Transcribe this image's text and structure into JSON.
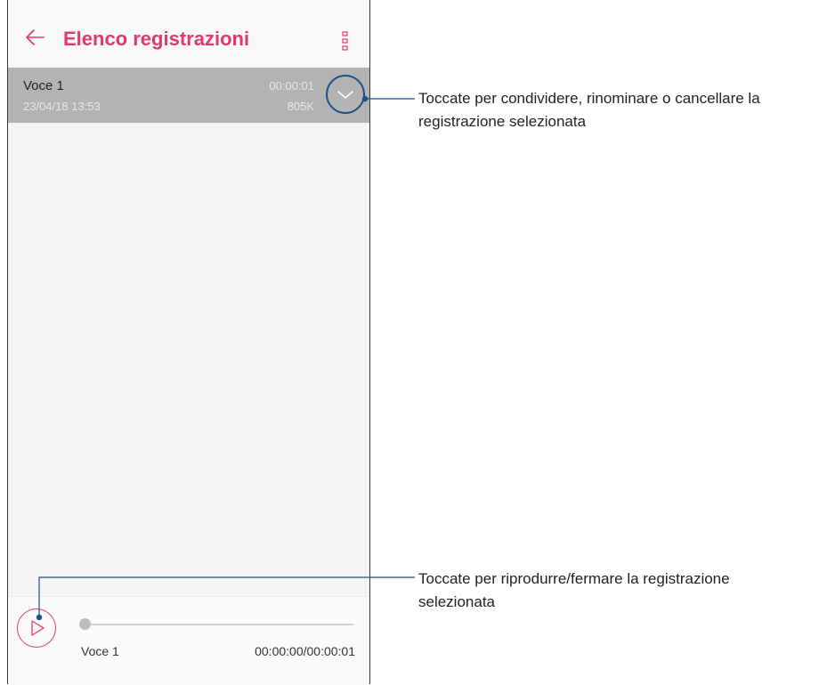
{
  "header": {
    "title": "Elenco registrazioni",
    "back_icon": "arrow-left-icon",
    "menu_icon": "more-vert-icon"
  },
  "recordings": [
    {
      "name": "Voce 1",
      "date": "23/04/18 13:53",
      "duration": "00:00:01",
      "size": "805K"
    }
  ],
  "player": {
    "name": "Voce 1",
    "time": "00:00:00/00:00:01",
    "progress": 0
  },
  "callouts": {
    "top": {
      "line1": "Toccate per condividere, rinominare o cancellare la",
      "line2": "registrazione selezionata"
    },
    "bottom": {
      "line1": "Toccate per riprodurre/fermare la registrazione",
      "line2": "selezionata"
    }
  },
  "colors": {
    "accent": "#e5386a",
    "callout_line": "#1a4f8a",
    "selected_row": "#b3b3b3"
  }
}
